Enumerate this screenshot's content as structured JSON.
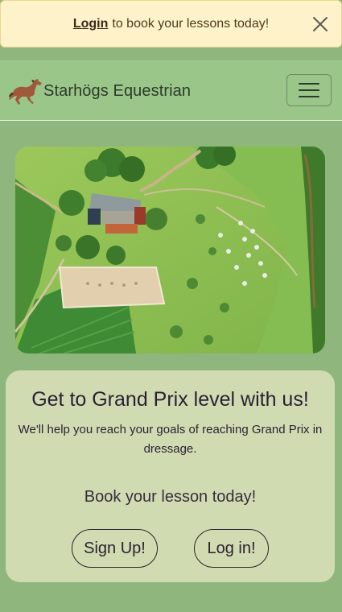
{
  "alert": {
    "link_label": "Login",
    "message": "to book your lessons today!",
    "close_icon": "close-icon"
  },
  "navbar": {
    "brand_name": "Starhögs Equestrian",
    "logo_icon": "horse-logo-icon",
    "toggler_icon": "hamburger-menu-icon"
  },
  "hero": {
    "image": "aerial-farm-photo"
  },
  "card": {
    "heading": "Get to Grand Prix level with us!",
    "subtitle": "We'll help you reach your goals of reaching Grand Prix in dressage.",
    "book_text": "Book your lesson today!",
    "signup_label": "Sign Up!",
    "login_label": "Log in!"
  },
  "colors": {
    "page_bg": "#8fb77d",
    "navbar_bg": "#9ac68a",
    "alert_bg": "#fdf2c9",
    "card_bg": "#d1dbb1",
    "text": "#2b2230"
  }
}
